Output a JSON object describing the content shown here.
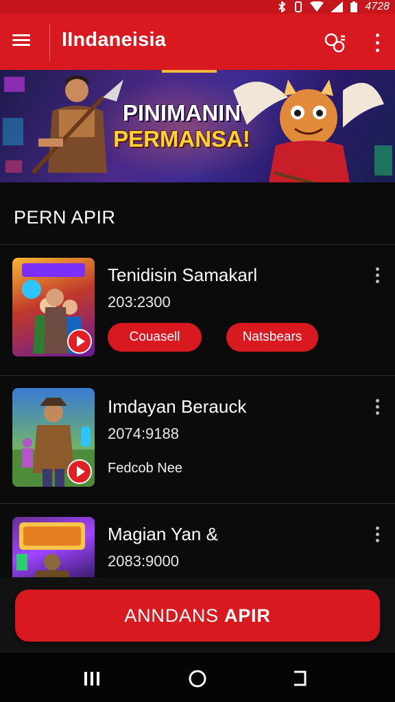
{
  "status_bar": {
    "time": "4728",
    "icons": [
      "bluetooth-icon",
      "vibrate-icon",
      "wifi-icon",
      "signal-icon",
      "battery-icon"
    ]
  },
  "app_bar": {
    "title": "IIndaneisia",
    "actions": [
      "people-icon",
      "more-vertical-icon"
    ]
  },
  "banner": {
    "line1": "PINIMANIN",
    "line2": "PERMANSA!"
  },
  "section": {
    "title": "PERN APIR"
  },
  "items": [
    {
      "title": "Tenidisin Samakarl",
      "subtitle": "203:2300",
      "chips": [
        "Couasell",
        "Natsbears"
      ]
    },
    {
      "title": "Imdayan Berauck",
      "subtitle": "2074:9188",
      "note": "Fedcob Nee"
    },
    {
      "title": "Magian Yan &",
      "subtitle": "2083:9000"
    }
  ],
  "cta": {
    "label_a": "ANNDANS",
    "label_b": "APIR"
  },
  "nav": {
    "buttons": [
      "recents-icon",
      "home-icon",
      "back-icon"
    ]
  },
  "colors": {
    "accent": "#d8191f",
    "status_bar": "#c4161c",
    "background": "#0b0b0c"
  }
}
